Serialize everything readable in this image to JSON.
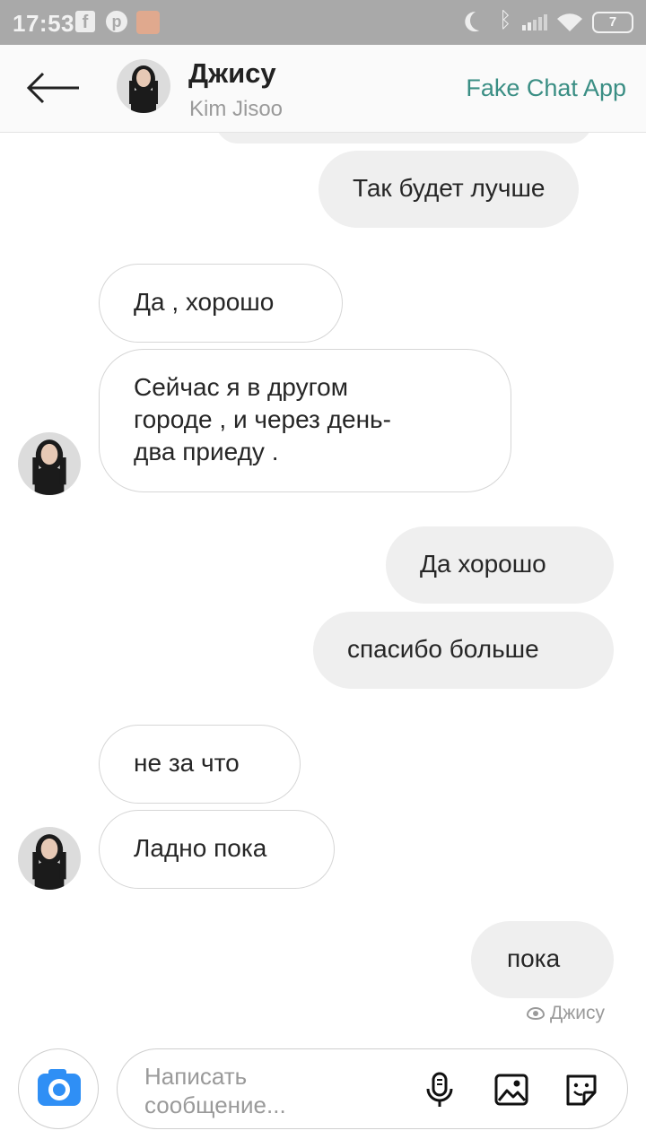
{
  "status_bar": {
    "time": "17:53",
    "battery": "7",
    "icons": [
      "facebook-icon",
      "pinterest-icon",
      "app-icon",
      "moon-icon",
      "bluetooth-icon",
      "signal-icon",
      "wifi-icon",
      "battery-icon"
    ]
  },
  "header": {
    "contact_name": "Джису",
    "contact_subtitle": "Kim Jisoo",
    "brand": "Fake Chat App",
    "back_icon": "arrow-left-icon"
  },
  "messages": [
    {
      "side": "out",
      "text": "Так будет лучше"
    },
    {
      "side": "in",
      "text": "Да , хорошо"
    },
    {
      "side": "in",
      "lines": [
        "Сейчас я в другом",
        "городе , и через день-",
        "два приеду ."
      ]
    },
    {
      "side": "out",
      "text": "Да хорошо"
    },
    {
      "side": "out",
      "text": "спасибо больше"
    },
    {
      "side": "in",
      "text": "не за что"
    },
    {
      "side": "in",
      "text": "Ладно пока"
    },
    {
      "side": "out",
      "text": "пока"
    }
  ],
  "seen": {
    "label": "Джису",
    "icon": "eye-icon"
  },
  "composer": {
    "placeholder": "Написать сообщение...",
    "icons": [
      "camera-icon",
      "microphone-icon",
      "image-icon",
      "sticker-icon"
    ],
    "accent_color": "#2f8ff5"
  },
  "colors": {
    "brand": "#3a8e84",
    "outgoing_bubble": "#efefef",
    "incoming_border": "#d6d6d6",
    "status_bar": "#a9a9a9"
  }
}
